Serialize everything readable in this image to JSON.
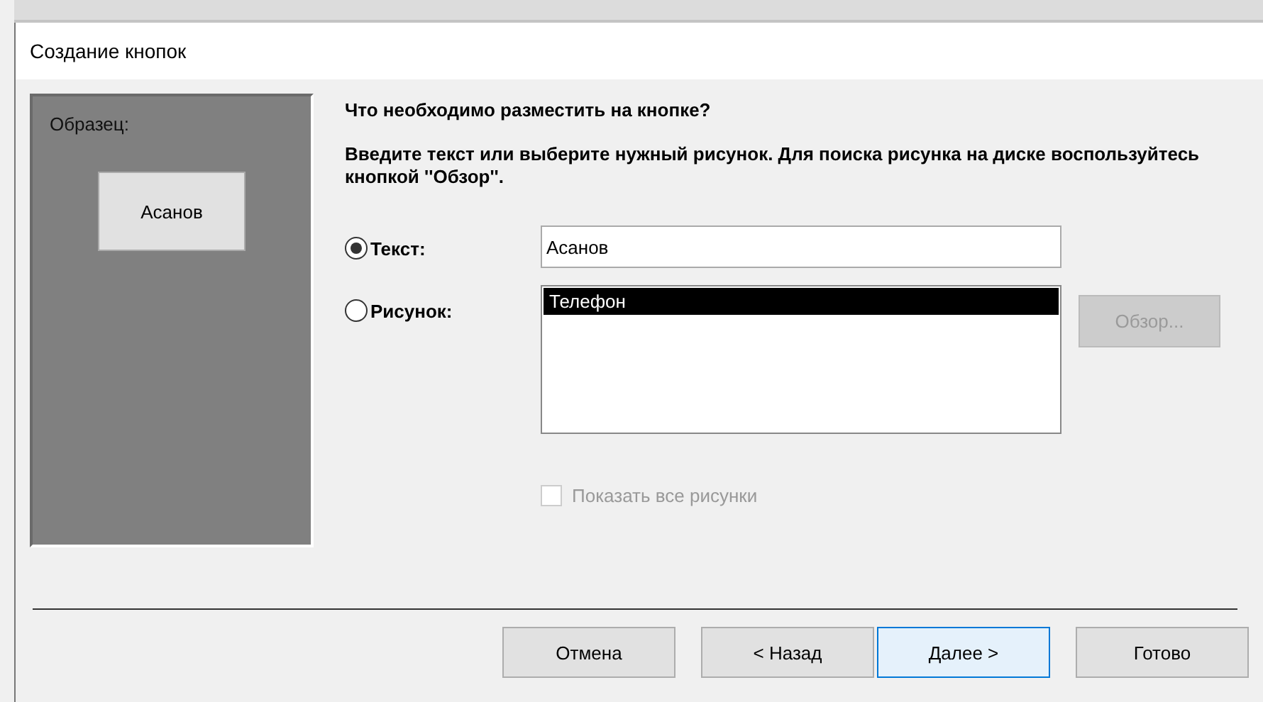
{
  "window": {
    "title": "Создание кнопок"
  },
  "preview": {
    "label": "Образец:",
    "button_label": "Асанов"
  },
  "question": "Что необходимо разместить на кнопке?",
  "instructions": "Введите текст или выберите нужный рисунок.  Для поиска рисунка на диске воспользуйтесь кнопкой ''Обзор''.",
  "options": [
    {
      "kind": "text",
      "label": "Текст:",
      "selected": true,
      "value": "Асанов"
    },
    {
      "kind": "picture",
      "label": "Рисунок:",
      "selected": false,
      "items": [
        {
          "label": "Телефон",
          "selected": true
        }
      ],
      "browse": {
        "label": "Обзор...",
        "disabled": true
      }
    }
  ],
  "show_all": {
    "label": "Показать все рисунки",
    "checked": false,
    "disabled": true
  },
  "buttons": [
    {
      "label": "Отмена",
      "focused": false
    },
    {
      "label": "< Назад",
      "focused": false
    },
    {
      "label": "Далее >",
      "focused": true
    },
    {
      "label": "Готово",
      "focused": false
    }
  ]
}
